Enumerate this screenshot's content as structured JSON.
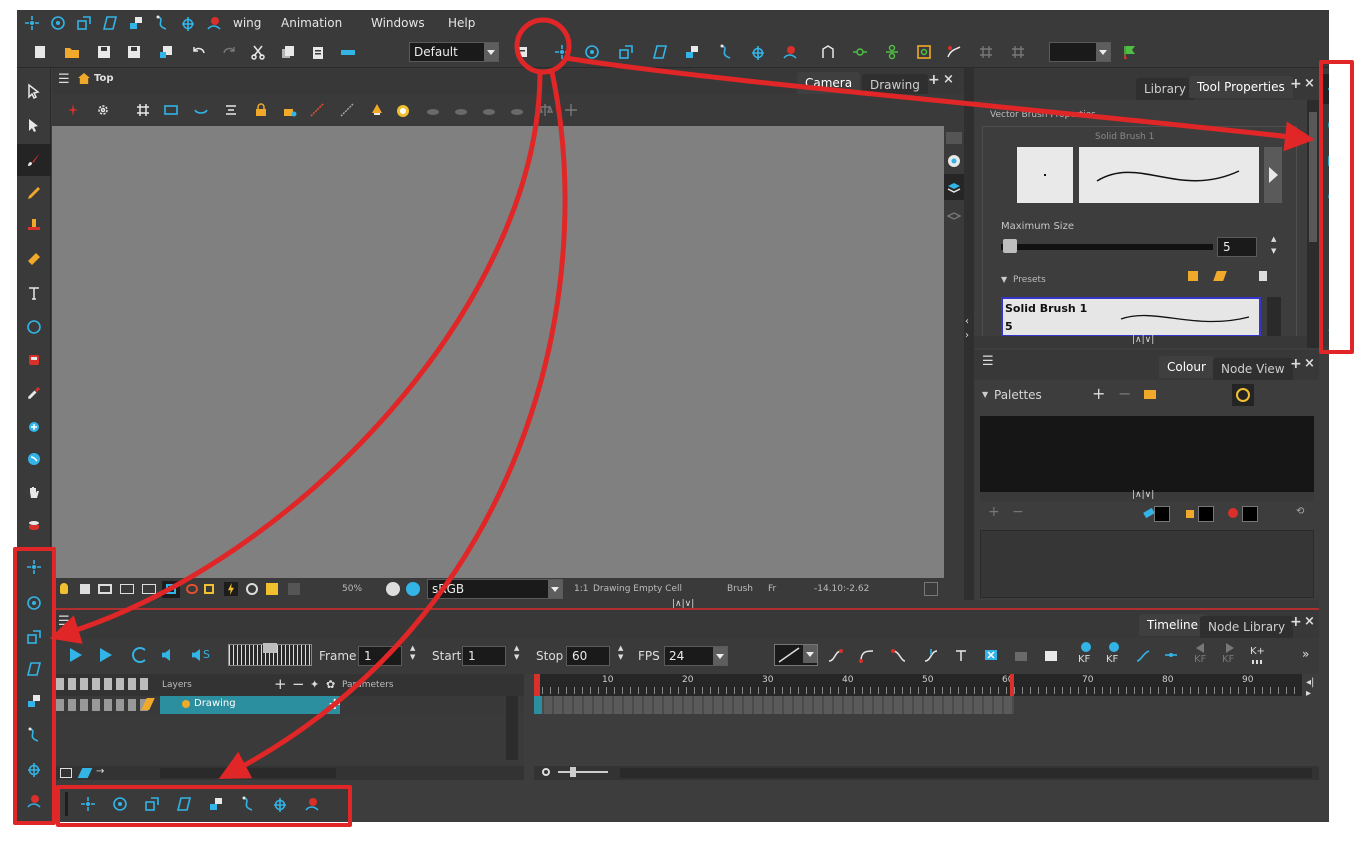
{
  "menu": {
    "items": [
      "wing",
      "Animation",
      "Windows",
      "Help"
    ]
  },
  "toolbar": {
    "workspace_value": "Default"
  },
  "camera_view": {
    "breadcrumb": "Top",
    "tabs": [
      "Camera",
      "Drawing"
    ],
    "status": {
      "zoom": "50%",
      "colorspace": "sRGB",
      "ratio": "1:1",
      "cell_info": "Drawing Empty Cell",
      "tool": "Brush",
      "frame_label": "Fr",
      "coords": "-14.10:-2.62"
    }
  },
  "tool_properties": {
    "tabs": [
      "Library",
      "Tool Properties"
    ],
    "section_title": "Vector Brush Properties",
    "brush_caption": "Solid Brush 1",
    "max_size_label": "Maximum Size",
    "max_size_value": "5",
    "presets_label": "Presets",
    "preset": {
      "name": "Solid Brush 1",
      "size": "5"
    }
  },
  "colour_view": {
    "tabs": [
      "Colour",
      "Node View"
    ],
    "palettes_label": "Palettes"
  },
  "timeline": {
    "tabs": [
      "Timeline",
      "Node Library"
    ],
    "frame_label": "Frame",
    "frame_value": "1",
    "start_label": "Start",
    "start_value": "1",
    "stop_label": "Stop",
    "stop_value": "60",
    "fps_label": "FPS",
    "fps_value": "24",
    "layers_header": "Layers",
    "parameters_header": "Parameters",
    "layer_name": "Drawing",
    "ruler_ticks": [
      "10",
      "20",
      "30",
      "40",
      "50",
      "60",
      "70",
      "80",
      "90"
    ],
    "kf_labels": [
      "KF",
      "KF",
      "KF",
      "KF",
      "K+"
    ]
  }
}
